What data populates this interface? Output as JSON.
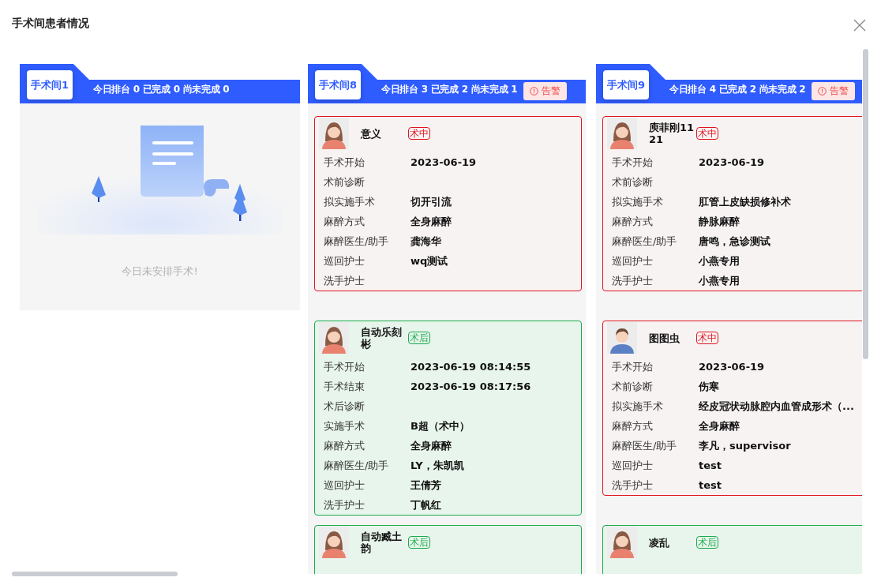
{
  "dialog": {
    "title": "手术间患者情况"
  },
  "rooms": [
    {
      "name": "手术间1",
      "stats": "今日排台 0 已完成 0 尚未完成 0",
      "empty_message": "今日未安排手术!"
    },
    {
      "name": "手术间8",
      "stats": "今日排台 3 已完成 2 尚未完成 1",
      "alert_button": "告警",
      "patients": [
        {
          "name": "意义",
          "avatar": {
            "kind": "woman"
          },
          "kind": "in_surgery",
          "status_label": "术中",
          "fields": [
            {
              "label": "手术开始",
              "value": "2023-06-19"
            },
            {
              "label": "术前诊断"
            },
            {
              "label": "拟实施手术",
              "value": "切开引流"
            },
            {
              "label": "麻醉方式",
              "value": "全身麻醉"
            },
            {
              "label": "麻醉医生/助手",
              "value": "龚海华"
            },
            {
              "label": "巡回护士",
              "value": "wq测试"
            },
            {
              "label": "洗手护士"
            }
          ]
        },
        {
          "name": "自动乐刻彬",
          "avatar": {
            "kind": "woman"
          },
          "kind": "post_op",
          "status_label": "术后",
          "fields": [
            {
              "label": "手术开始",
              "value": "2023-06-19 08:14:55"
            },
            {
              "label": "手术结束",
              "value": "2023-06-19 08:17:56"
            },
            {
              "label": "术后诊断"
            },
            {
              "label": "实施手术",
              "value": "B超（术中）"
            },
            {
              "label": "麻醉方式",
              "value": "全身麻醉"
            },
            {
              "label": "麻醉医生/助手",
              "value": "LY，朱凯凯"
            },
            {
              "label": "巡回护士",
              "value": "王倩芳"
            },
            {
              "label": "洗手护士",
              "value": "丁帆红"
            }
          ]
        },
        {
          "name": "自动臧土韵",
          "avatar": {
            "kind": "woman"
          },
          "kind": "post_op",
          "status_label": "术后"
        }
      ]
    },
    {
      "name": "手术间9",
      "stats": "今日排台 4 已完成 2 尚未完成 2",
      "alert_button": "告警",
      "patients": [
        {
          "name": "庾菲刚1121",
          "avatar": {
            "kind": "woman"
          },
          "kind": "in_surgery",
          "status_label": "术中",
          "fields": [
            {
              "label": "手术开始",
              "value": "2023-06-19"
            },
            {
              "label": "术前诊断"
            },
            {
              "label": "拟实施手术",
              "value": "肛管上皮缺损修补术"
            },
            {
              "label": "麻醉方式",
              "value": "静脉麻醉"
            },
            {
              "label": "麻醉医生/助手",
              "value": "唐鸣，急诊测试"
            },
            {
              "label": "巡回护士",
              "value": "小燕专用"
            },
            {
              "label": "洗手护士",
              "value": "小燕专用"
            }
          ]
        },
        {
          "name": "图图虫",
          "avatar": {
            "kind": "man"
          },
          "kind": "in_surgery",
          "status_label": "术中",
          "fields": [
            {
              "label": "手术开始",
              "value": "2023-06-19"
            },
            {
              "label": "术前诊断",
              "value": "伤寒"
            },
            {
              "label": "拟实施手术",
              "value": "经皮冠状动脉腔内血管成形术（..."
            },
            {
              "label": "麻醉方式",
              "value": "全身麻醉"
            },
            {
              "label": "麻醉医生/助手",
              "value": "李凡，supervisor"
            },
            {
              "label": "巡回护士",
              "value": "test"
            },
            {
              "label": "洗手护士",
              "value": "test"
            }
          ]
        },
        {
          "name": "凌乱",
          "avatar": {
            "kind": "woman"
          },
          "kind": "post_op",
          "status_label": "术后"
        }
      ]
    }
  ]
}
